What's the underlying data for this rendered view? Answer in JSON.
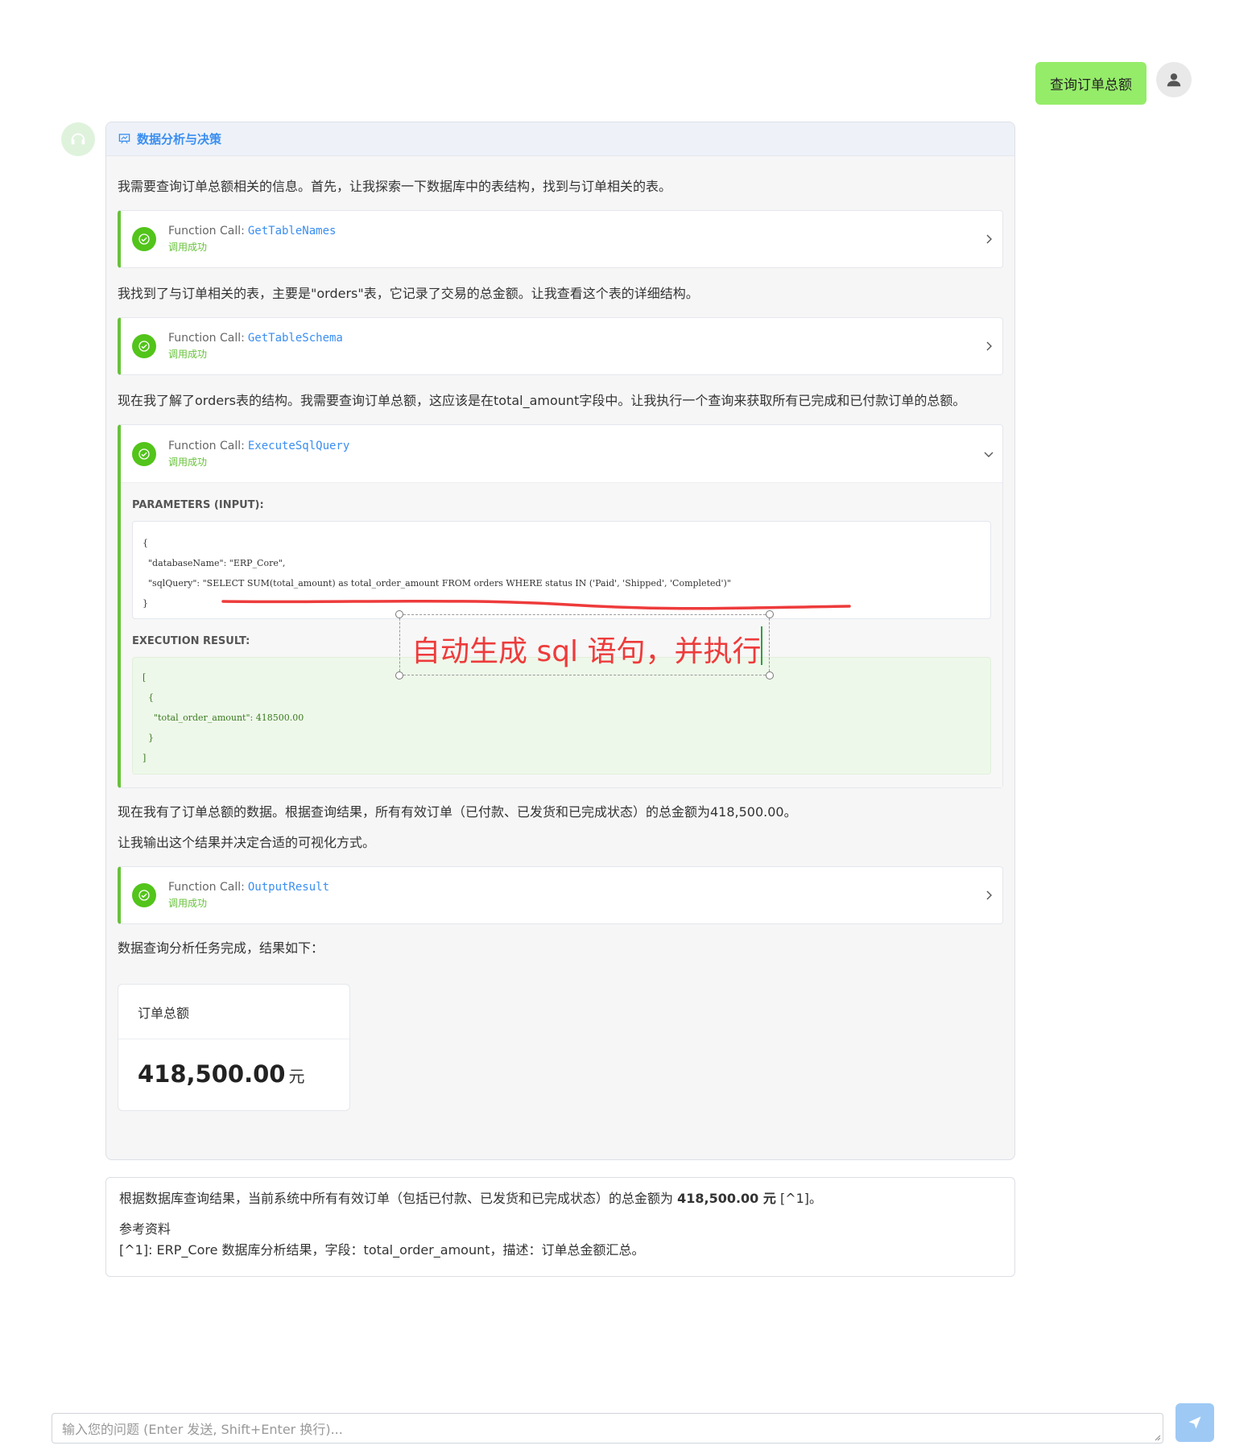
{
  "user_message": "查询订单总额",
  "assistant": {
    "header_title": "数据分析与决策",
    "para1": "我需要查询订单总额相关的信息。首先，让我探索一下数据库中的表结构，找到与订单相关的表。",
    "call1": {
      "label": "Function Call:",
      "name": "GetTableNames",
      "status": "调用成功"
    },
    "para2": "我找到了与订单相关的表，主要是\"orders\"表，它记录了交易的总金额。让我查看这个表的详细结构。",
    "call2": {
      "label": "Function Call:",
      "name": "GetTableSchema",
      "status": "调用成功"
    },
    "para3": "现在我了解了orders表的结构。我需要查询订单总额，这应该是在total_amount字段中。让我执行一个查询来获取所有已完成和已付款订单的总额。",
    "call3": {
      "label": "Function Call:",
      "name": "ExecuteSqlQuery",
      "status": "调用成功",
      "params_label": "PARAMETERS (INPUT):",
      "params_text": "{\n  \"databaseName\": \"ERP_Core\",\n  \"sqlQuery\": \"SELECT SUM(total_amount) as total_order_amount FROM orders WHERE status IN ('Paid', 'Shipped', 'Completed')\"\n}",
      "result_label": "EXECUTION RESULT:",
      "result_text": "[\n  {\n    \"total_order_amount\": 418500.00\n  }\n]"
    },
    "para4": "现在我有了订单总额的数据。根据查询结果，所有有效订单（已付款、已发货和已完成状态）的总金额为418,500.00。",
    "para5": "让我输出这个结果并决定合适的可视化方式。",
    "call4": {
      "label": "Function Call:",
      "name": "OutputResult",
      "status": "调用成功"
    },
    "para6": "数据查询分析任务完成，结果如下：",
    "result_card": {
      "title": "订单总额",
      "value": "418,500.00",
      "unit": "元"
    }
  },
  "summary": {
    "text_before": "根据数据库查询结果，当前系统中所有有效订单（包括已付款、已发货和已完成状态）的总金额为 ",
    "amount_bold": "418,500.00 元",
    "text_after": " [^1]。",
    "ref_title": "参考资料",
    "ref_item": "[^1]: ERP_Core 数据库分析结果，字段：total_order_amount，描述：订单总金额汇总。"
  },
  "annotation": {
    "text": "自动生成 sql 语句，并执行",
    "color": "#ee3b3b"
  },
  "input": {
    "placeholder": "输入您的问题 (Enter 发送, Shift+Enter 换行)..."
  },
  "colors": {
    "accent": "#3a8ef0",
    "success": "#67c23a",
    "user_bubble": "#95ec69",
    "send_button": "#9ec9f5"
  }
}
